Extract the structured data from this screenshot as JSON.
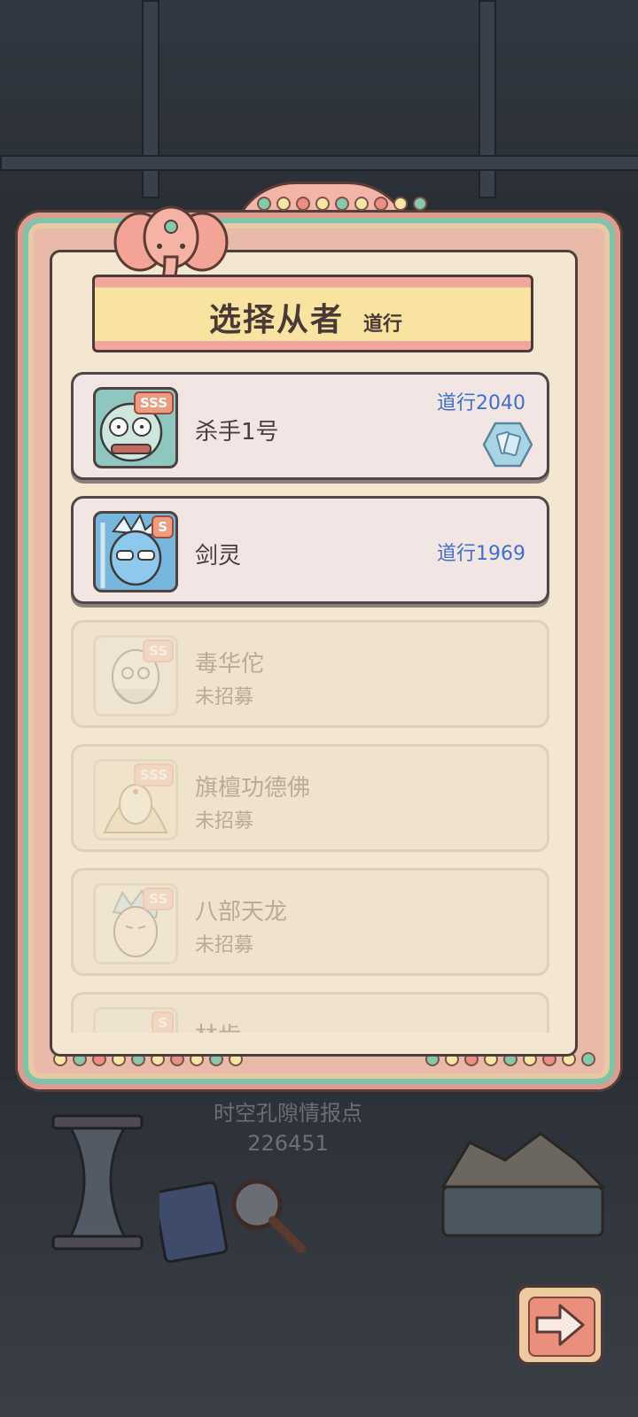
{
  "title": {
    "main": "选择从者",
    "sub": "道行"
  },
  "followers": [
    {
      "name": "杀手1号",
      "rank": "SSS",
      "power": "道行2040",
      "status": "",
      "state": "recruited",
      "badge_icon": "hexagon-cards-icon"
    },
    {
      "name": "剑灵",
      "rank": "S",
      "power": "道行1969",
      "status": "",
      "state": "recruited"
    },
    {
      "name": "毒华佗",
      "rank": "SS",
      "power": "",
      "status": "未招募",
      "state": "locked"
    },
    {
      "name": "旗檀功德佛",
      "rank": "SSS",
      "power": "",
      "status": "未招募",
      "state": "locked"
    },
    {
      "name": "八部天龙",
      "rank": "SS",
      "power": "",
      "status": "未招募",
      "state": "locked"
    },
    {
      "name": "林齿",
      "rank": "S",
      "power": "",
      "status": "",
      "state": "locked"
    }
  ],
  "info": {
    "label": "时空孔隙情报点",
    "value": "226451"
  },
  "next_button": {
    "icon": "arrow-right-icon"
  },
  "colors": {
    "power": "#3f6fd0",
    "frame": "#e9b9a9",
    "panel": "#f3e7d2"
  }
}
